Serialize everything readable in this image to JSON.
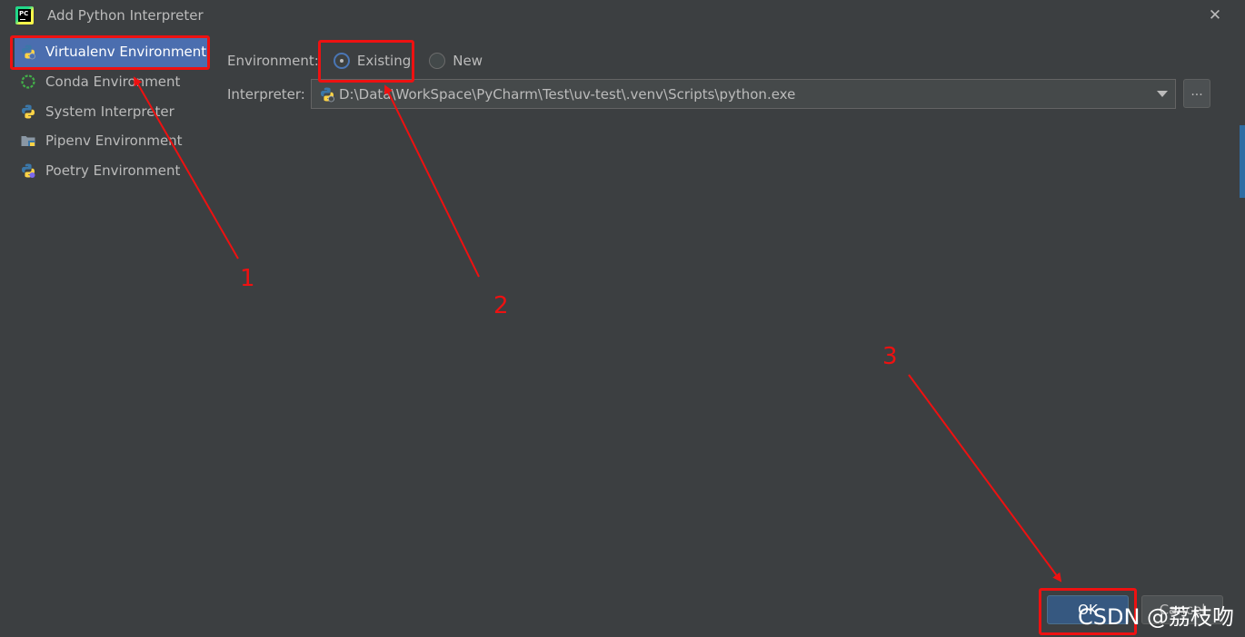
{
  "window": {
    "title": "Add Python Interpreter",
    "close_icon": "close-icon"
  },
  "sidebar": {
    "items": [
      {
        "label": "Virtualenv Environment",
        "icon": "python-venv-icon",
        "selected": true
      },
      {
        "label": "Conda Environment",
        "icon": "conda-icon",
        "selected": false
      },
      {
        "label": "System Interpreter",
        "icon": "python-icon",
        "selected": false
      },
      {
        "label": "Pipenv Environment",
        "icon": "pipenv-icon",
        "selected": false
      },
      {
        "label": "Poetry Environment",
        "icon": "poetry-icon",
        "selected": false
      }
    ]
  },
  "form": {
    "environment_label": "Environment:",
    "option_existing": "Existing",
    "option_new": "New",
    "selected_option": "Existing",
    "interpreter_label": "Interpreter:",
    "interpreter_value": "D:\\Data\\WorkSpace\\PyCharm\\Test\\uv-test\\.venv\\Scripts\\python.exe",
    "browse_label": "..."
  },
  "buttons": {
    "ok_label": "OK",
    "cancel_label": "Cancel"
  },
  "annotations": {
    "step1": "1",
    "step2": "2",
    "step3": "3",
    "color": "#ee1111"
  },
  "watermark": "CSDN @荔枝吻",
  "colors": {
    "background": "#3c3f41",
    "selection": "#4b6eaf",
    "ok_button": "#365880"
  }
}
